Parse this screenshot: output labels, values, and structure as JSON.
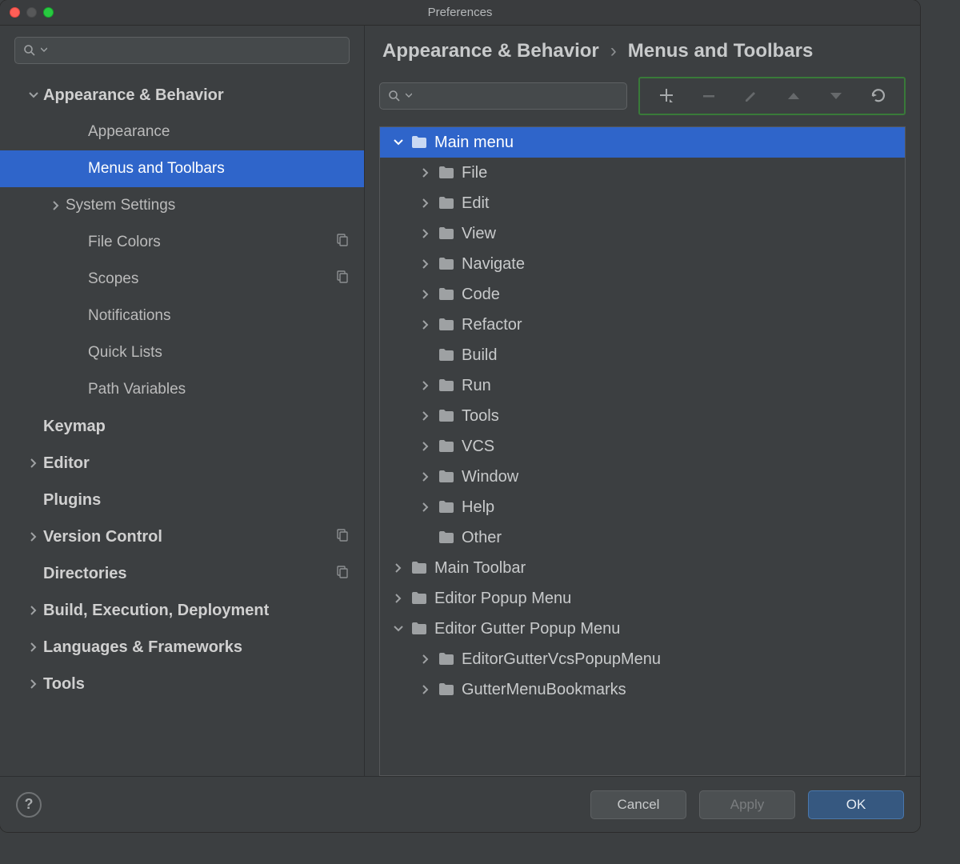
{
  "window": {
    "title": "Preferences"
  },
  "search": {
    "placeholder": ""
  },
  "sidebar": {
    "items": [
      {
        "label": "Appearance & Behavior",
        "level": 1,
        "arrow": "down",
        "bold": true
      },
      {
        "label": "Appearance",
        "level": 3,
        "arrow": "",
        "bold": false
      },
      {
        "label": "Menus and Toolbars",
        "level": 3,
        "arrow": "",
        "bold": false,
        "selected": true
      },
      {
        "label": "System Settings",
        "level": 2,
        "arrow": "right",
        "bold": false
      },
      {
        "label": "File Colors",
        "level": 3,
        "arrow": "",
        "bold": false,
        "badge": "copy"
      },
      {
        "label": "Scopes",
        "level": 3,
        "arrow": "",
        "bold": false,
        "badge": "copy"
      },
      {
        "label": "Notifications",
        "level": 3,
        "arrow": "",
        "bold": false
      },
      {
        "label": "Quick Lists",
        "level": 3,
        "arrow": "",
        "bold": false
      },
      {
        "label": "Path Variables",
        "level": 3,
        "arrow": "",
        "bold": false
      },
      {
        "label": "Keymap",
        "level": 1,
        "arrow": "",
        "bold": true
      },
      {
        "label": "Editor",
        "level": 1,
        "arrow": "right",
        "bold": true
      },
      {
        "label": "Plugins",
        "level": 1,
        "arrow": "",
        "bold": true
      },
      {
        "label": "Version Control",
        "level": 1,
        "arrow": "right",
        "bold": true,
        "badge": "copy"
      },
      {
        "label": "Directories",
        "level": 1,
        "arrow": "",
        "bold": true,
        "badge": "copy"
      },
      {
        "label": "Build, Execution, Deployment",
        "level": 1,
        "arrow": "right",
        "bold": true
      },
      {
        "label": "Languages & Frameworks",
        "level": 1,
        "arrow": "right",
        "bold": true
      },
      {
        "label": "Tools",
        "level": 1,
        "arrow": "right",
        "bold": true
      }
    ]
  },
  "breadcrumb": {
    "parent": "Appearance & Behavior",
    "sep": "›",
    "current": "Menus and Toolbars"
  },
  "toolbar": {
    "actions": [
      "add",
      "remove",
      "edit",
      "up",
      "down",
      "reset"
    ]
  },
  "tree": {
    "items": [
      {
        "label": "Main menu",
        "level": 1,
        "arrow": "down",
        "selected": true
      },
      {
        "label": "File",
        "level": 2,
        "arrow": "right"
      },
      {
        "label": "Edit",
        "level": 2,
        "arrow": "right"
      },
      {
        "label": "View",
        "level": 2,
        "arrow": "right"
      },
      {
        "label": "Navigate",
        "level": 2,
        "arrow": "right"
      },
      {
        "label": "Code",
        "level": 2,
        "arrow": "right"
      },
      {
        "label": "Refactor",
        "level": 2,
        "arrow": "right"
      },
      {
        "label": "Build",
        "level": 2,
        "arrow": ""
      },
      {
        "label": "Run",
        "level": 2,
        "arrow": "right"
      },
      {
        "label": "Tools",
        "level": 2,
        "arrow": "right"
      },
      {
        "label": "VCS",
        "level": 2,
        "arrow": "right"
      },
      {
        "label": "Window",
        "level": 2,
        "arrow": "right"
      },
      {
        "label": "Help",
        "level": 2,
        "arrow": "right"
      },
      {
        "label": "Other",
        "level": 2,
        "arrow": ""
      },
      {
        "label": "Main Toolbar",
        "level": 1,
        "arrow": "right"
      },
      {
        "label": "Editor Popup Menu",
        "level": 1,
        "arrow": "right"
      },
      {
        "label": "Editor Gutter Popup Menu",
        "level": 1,
        "arrow": "down"
      },
      {
        "label": "EditorGutterVcsPopupMenu",
        "level": 2,
        "arrow": "right"
      },
      {
        "label": "GutterMenuBookmarks",
        "level": 2,
        "arrow": "right"
      }
    ]
  },
  "footer": {
    "help": "?",
    "cancel": "Cancel",
    "apply": "Apply",
    "ok": "OK"
  }
}
